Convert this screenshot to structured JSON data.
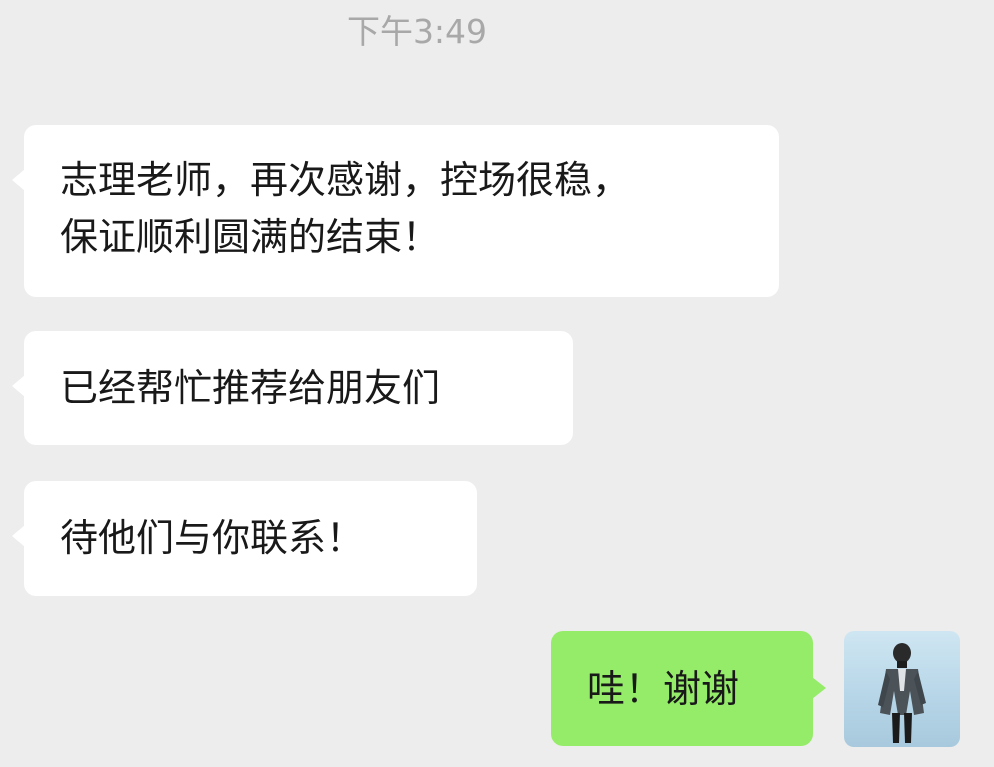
{
  "chat": {
    "timestamp": "下午3:49",
    "messages": [
      {
        "side": "incoming",
        "text": "志理老师，再次感谢，控场很稳，\n保证顺利圆满的结束！"
      },
      {
        "side": "incoming",
        "text": "已经帮忙推荐给朋友们"
      },
      {
        "side": "incoming",
        "text": "待他们与你联系！"
      },
      {
        "side": "outgoing",
        "text": "哇！谢谢"
      }
    ]
  },
  "colors": {
    "background": "#ededed",
    "incoming_bubble": "#ffffff",
    "outgoing_bubble": "#95ec69",
    "timestamp_text": "#a8a8a8",
    "message_text": "#191919"
  },
  "icons": {
    "self_avatar": "user-avatar-photo"
  }
}
